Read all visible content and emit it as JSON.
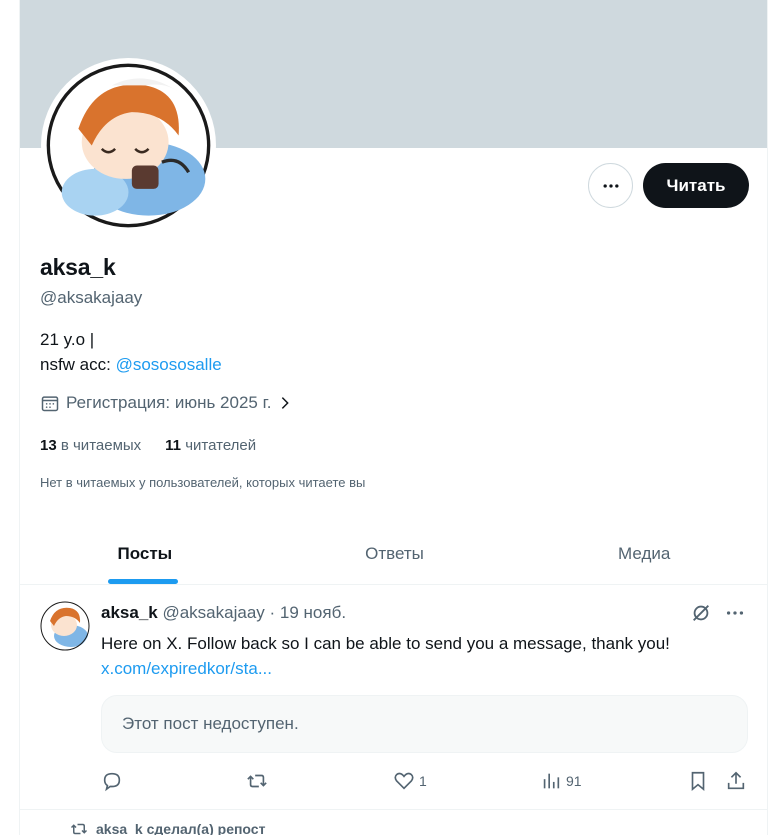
{
  "profile": {
    "name": "aksa_k",
    "handle": "@aksakajaay",
    "bio_line1": "21 y.o |",
    "bio_line2_prefix": "nsfw acc: ",
    "bio_link": "@sosososalle",
    "joined": "Регистрация: июнь 2025 г.",
    "following_count": "13",
    "following_label": "в читаемых",
    "followers_count": "11",
    "followers_label": "читателей",
    "not_followed_note": "Нет в читаемых у пользователей, которых читаете вы"
  },
  "buttons": {
    "follow": "Читать",
    "more_icon": "ellipsis-icon"
  },
  "tabs": [
    {
      "label": "Посты",
      "active": true
    },
    {
      "label": "Ответы",
      "active": false
    },
    {
      "label": "Медиа",
      "active": false
    }
  ],
  "tweet": {
    "author": "aksa_k",
    "handle": "@aksakajaay",
    "date": "· 19 нояб.",
    "text": "Here on X. Follow back so I can be able to send you a message, thank you!",
    "link": "x.com/expiredkor/sta...",
    "unavailable": "Этот пост недоступен.",
    "likes": "1",
    "views": "91"
  },
  "repost_note": "aksa_k сделал(а) репост",
  "colors": {
    "accent": "#1d9bf0",
    "banner": "#cfd9de",
    "text_primary": "#0f1419",
    "text_secondary": "#536471"
  }
}
